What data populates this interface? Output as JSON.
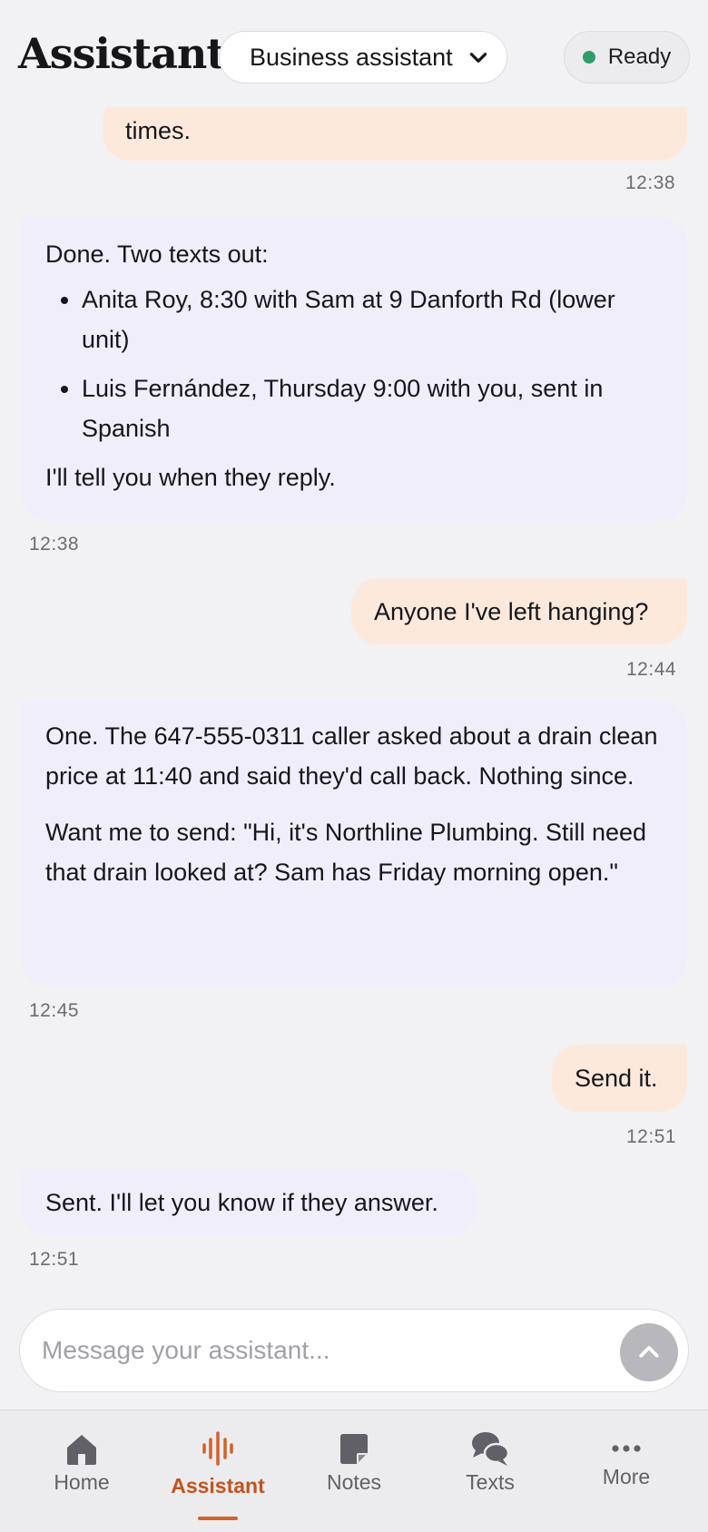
{
  "header": {
    "title": "Assistant",
    "mode_select": "Business assistant",
    "status": "Ready"
  },
  "messages": [
    {
      "role": "user",
      "text": "times.",
      "time": "12:38"
    },
    {
      "role": "assistant",
      "intro": "Done. Two texts out:",
      "items": [
        "Anita Roy, 8:30 with Sam at 9 Danforth Rd (lower unit)",
        "Luis Fernández, Thursday 9:00 with you, sent in Spanish"
      ],
      "outro": "I'll tell you when they reply.",
      "time": "12:38"
    },
    {
      "role": "user",
      "text": "Anyone I've left hanging?",
      "time": "12:44"
    },
    {
      "role": "assistant",
      "p1": "One. The 647-555-0311 caller asked about a drain clean price at 11:40 and said they'd call back. Nothing since.",
      "p2": "Want me to send: \"Hi, it's Northline Plumbing. Still need that drain looked at? Sam has Friday morning open.\"",
      "time": "12:45"
    },
    {
      "role": "user",
      "text": "Send it.",
      "time": "12:51"
    },
    {
      "role": "assistant",
      "text": "Sent. I'll let you know if they answer.",
      "time": "12:51"
    }
  ],
  "composer": {
    "placeholder": "Message your assistant..."
  },
  "nav": {
    "items": [
      {
        "label": "Home",
        "icon": "home-icon"
      },
      {
        "label": "Assistant",
        "icon": "waveform-icon",
        "active": true
      },
      {
        "label": "Notes",
        "icon": "note-icon"
      },
      {
        "label": "Texts",
        "icon": "chat-bubbles-icon"
      },
      {
        "label": "More",
        "icon": "more-dots-icon"
      }
    ]
  },
  "colors": {
    "accent": "#c2541c",
    "user_bubble": "#fce9dc",
    "assistant_bubble": "#f0eefa",
    "status_ready": "#2f9e6a"
  }
}
